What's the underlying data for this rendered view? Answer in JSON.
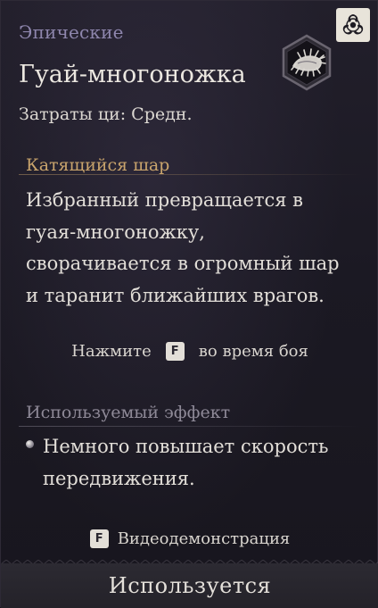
{
  "card": {
    "rarity": "Эпические",
    "title": "Гуай-многоножка",
    "cost": "Затраты ци: Средн.",
    "badge_icon": "biohazard-icon",
    "skill_icon": "centipede-skill-icon"
  },
  "skill": {
    "name": "Катящийся шар",
    "description_lines": [
      "Избранный превращается в",
      "гуая-многоножку,",
      "сворачивается в огромный шар",
      "и таранит ближайших врагов."
    ]
  },
  "hint": {
    "before": "Нажмите",
    "key": "F",
    "after": "во время боя"
  },
  "effect": {
    "heading": "Используемый эффект",
    "lines": [
      "Немного повышает скорость",
      "передвижения."
    ]
  },
  "video": {
    "key": "F",
    "label": "Видеодемонстрация"
  },
  "status": {
    "label": "Используется"
  },
  "colors": {
    "rarity": "#8e86ad",
    "section_gold": "#c9a46c",
    "section_grey": "#8f8a98"
  }
}
